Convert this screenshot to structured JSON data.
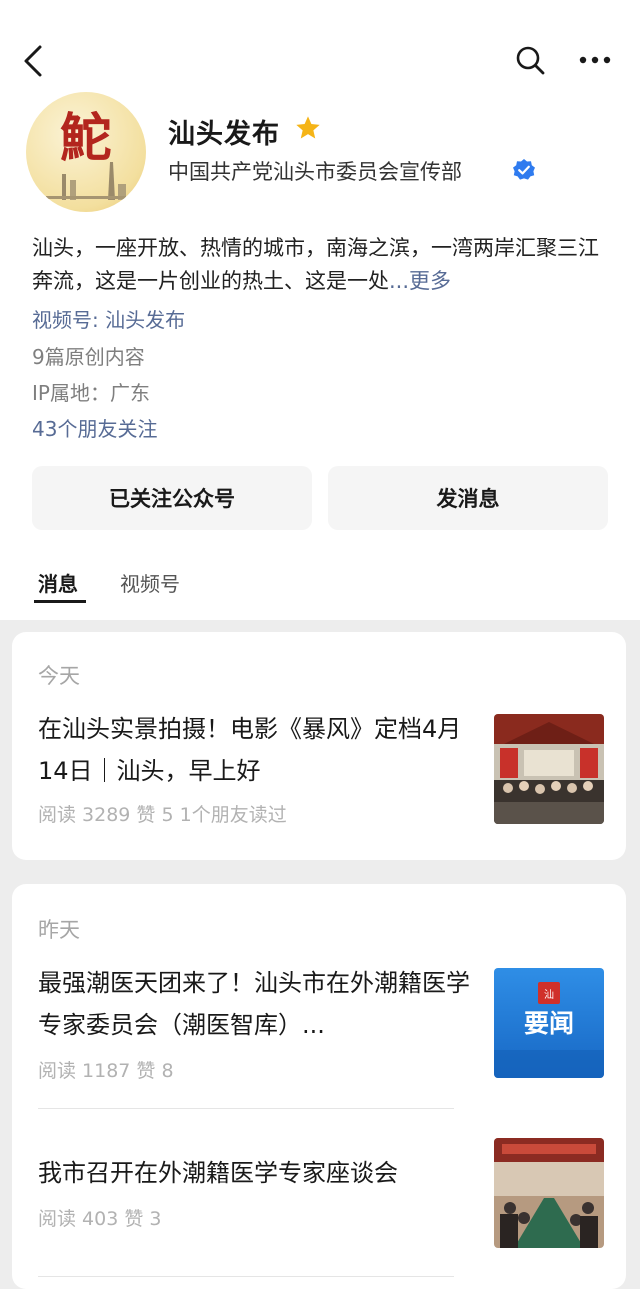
{
  "header": {
    "back_icon": "chevron-left-icon",
    "search_icon": "search-icon",
    "more_icon": "more-dots-icon"
  },
  "profile": {
    "avatar_text": "鮀",
    "name": "汕头发布",
    "org": "中国共产党汕头市委员会宣传部",
    "description": "汕头，一座开放、热情的城市，南海之滨，一湾两岸汇聚三江奔流，这是一片创业的热土、这是一处",
    "description_more": "...更多",
    "video_channel": "视频号: 汕头发布",
    "original_count": "9篇原创内容",
    "ip_location": "IP属地：广东",
    "friends_following": "43个朋友关注",
    "star_color": "#f5b417",
    "verify_color": "#2f7bef"
  },
  "actions": {
    "follow_label": "已关注公众号",
    "message_label": "发消息"
  },
  "tabs": [
    {
      "label": "消息"
    },
    {
      "label": "视频号"
    }
  ],
  "feed": {
    "today": {
      "label": "今天",
      "articles": [
        {
          "title": "在汕头实景拍摄！电影《暴风》定档4月14日｜汕头，早上好",
          "stats": "阅读 3289  赞 5  1个朋友读过"
        }
      ]
    },
    "yesterday": {
      "label": "昨天",
      "articles": [
        {
          "title": "最强潮医天团来了！汕头市在外潮籍医学专家委员会（潮医智库）...",
          "stats": "阅读 1187  赞 8",
          "thumb_text": "要闻"
        },
        {
          "title": "我市召开在外潮籍医学专家座谈会",
          "stats": "阅读 403  赞 3"
        }
      ]
    }
  }
}
